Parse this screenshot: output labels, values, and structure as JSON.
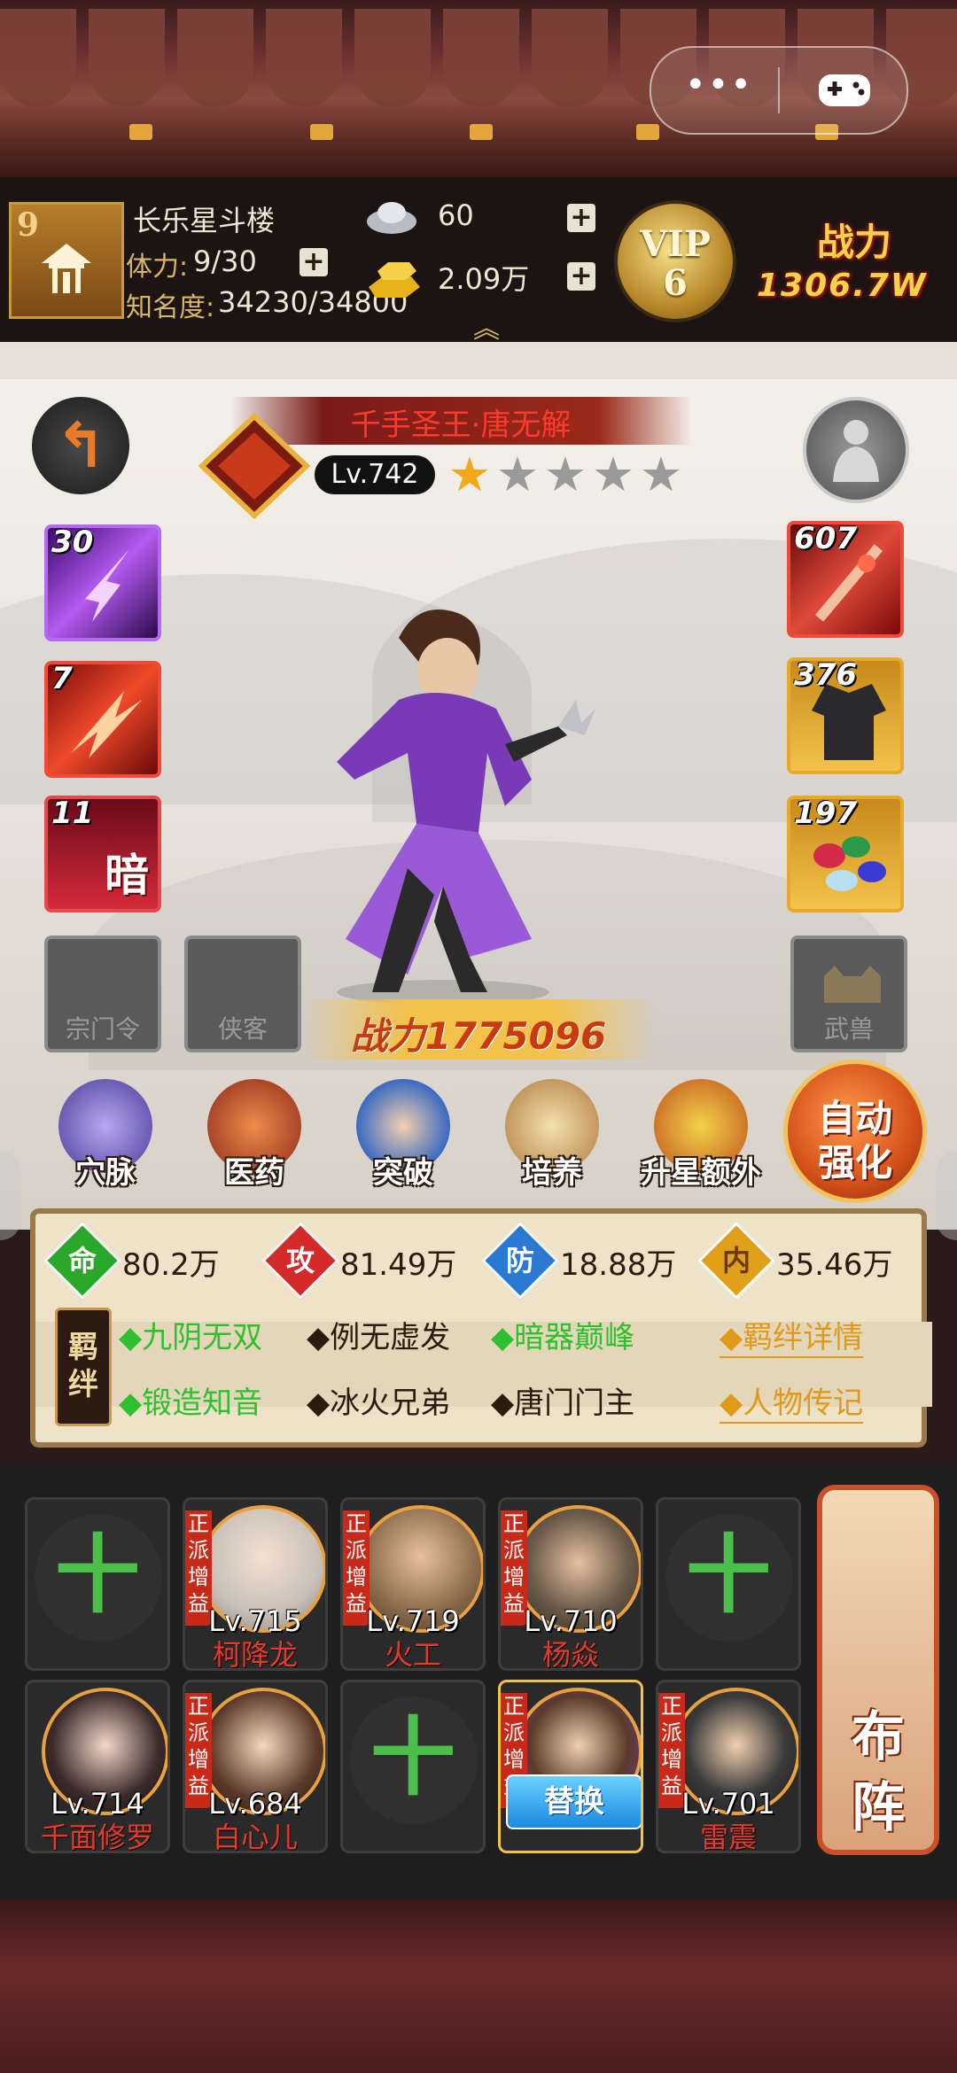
{
  "player": {
    "level": "9",
    "name": "长乐星斗楼",
    "stamina_label": "体力:",
    "stamina_value": "9/30",
    "fame_label": "知名度:",
    "fame_value": "34230/34800"
  },
  "currency": {
    "silver": "60",
    "gold": "2.09万"
  },
  "vip": {
    "label": "VIP",
    "level": "6"
  },
  "total_power": {
    "label": "战力",
    "value": "1306.7W"
  },
  "hero": {
    "name": "千手圣王·唐无解",
    "level": "Lv.742",
    "stars_filled": 1,
    "stars_total": 5,
    "power_text": "战力1775096",
    "skills": [
      "30",
      "7",
      "11"
    ],
    "equipment": [
      "607",
      "376",
      "197"
    ],
    "skill_badge": "暗",
    "empty_slots": [
      "宗门令",
      "侠客",
      "武兽"
    ]
  },
  "functions": [
    {
      "label": "穴脉",
      "icon": "meridian-icon"
    },
    {
      "label": "医药",
      "icon": "medicine-icon"
    },
    {
      "label": "突破",
      "icon": "breakthrough-icon"
    },
    {
      "label": "培养",
      "icon": "cultivate-icon"
    },
    {
      "label": "升星额外",
      "icon": "star-up-icon"
    }
  ],
  "auto_enhance": {
    "line1": "自动",
    "line2": "强化"
  },
  "stats": [
    {
      "icon": "命",
      "value": "80.2万",
      "color": "#2aa82a"
    },
    {
      "icon": "攻",
      "value": "81.49万",
      "color": "#d42a2a"
    },
    {
      "icon": "防",
      "value": "18.88万",
      "color": "#2a7ad4"
    },
    {
      "icon": "内",
      "value": "35.46万",
      "color": "#e0a01a"
    }
  ],
  "bonds_label": {
    "line1": "羁",
    "line2": "绊"
  },
  "bonds": [
    {
      "text": "◆九阴无双",
      "active": true
    },
    {
      "text": "◆例无虚发",
      "active": false
    },
    {
      "text": "◆暗器巅峰",
      "active": true
    },
    {
      "text": "◆锻造知音",
      "active": true
    },
    {
      "text": "◆冰火兄弟",
      "active": false
    },
    {
      "text": "◆唐门门主",
      "active": false
    }
  ],
  "links": {
    "bond_detail": "◆羁绊详情",
    "biography": "◆人物传记"
  },
  "lineup": {
    "tag": "正派增益",
    "cards": [
      {
        "empty": true
      },
      {
        "level": "Lv.715",
        "name": "柯降龙"
      },
      {
        "level": "Lv.719",
        "name": "火工"
      },
      {
        "level": "Lv.710",
        "name": "杨焱"
      },
      {
        "empty": true
      },
      {
        "level": "Lv.714",
        "name": "千面修罗"
      },
      {
        "level": "Lv.684",
        "name": "白心儿"
      },
      {
        "empty": true
      },
      {
        "replace": "替换"
      },
      {
        "level": "Lv.701",
        "name": "雷震"
      }
    ],
    "formation_line1": "布",
    "formation_line2": "阵"
  }
}
